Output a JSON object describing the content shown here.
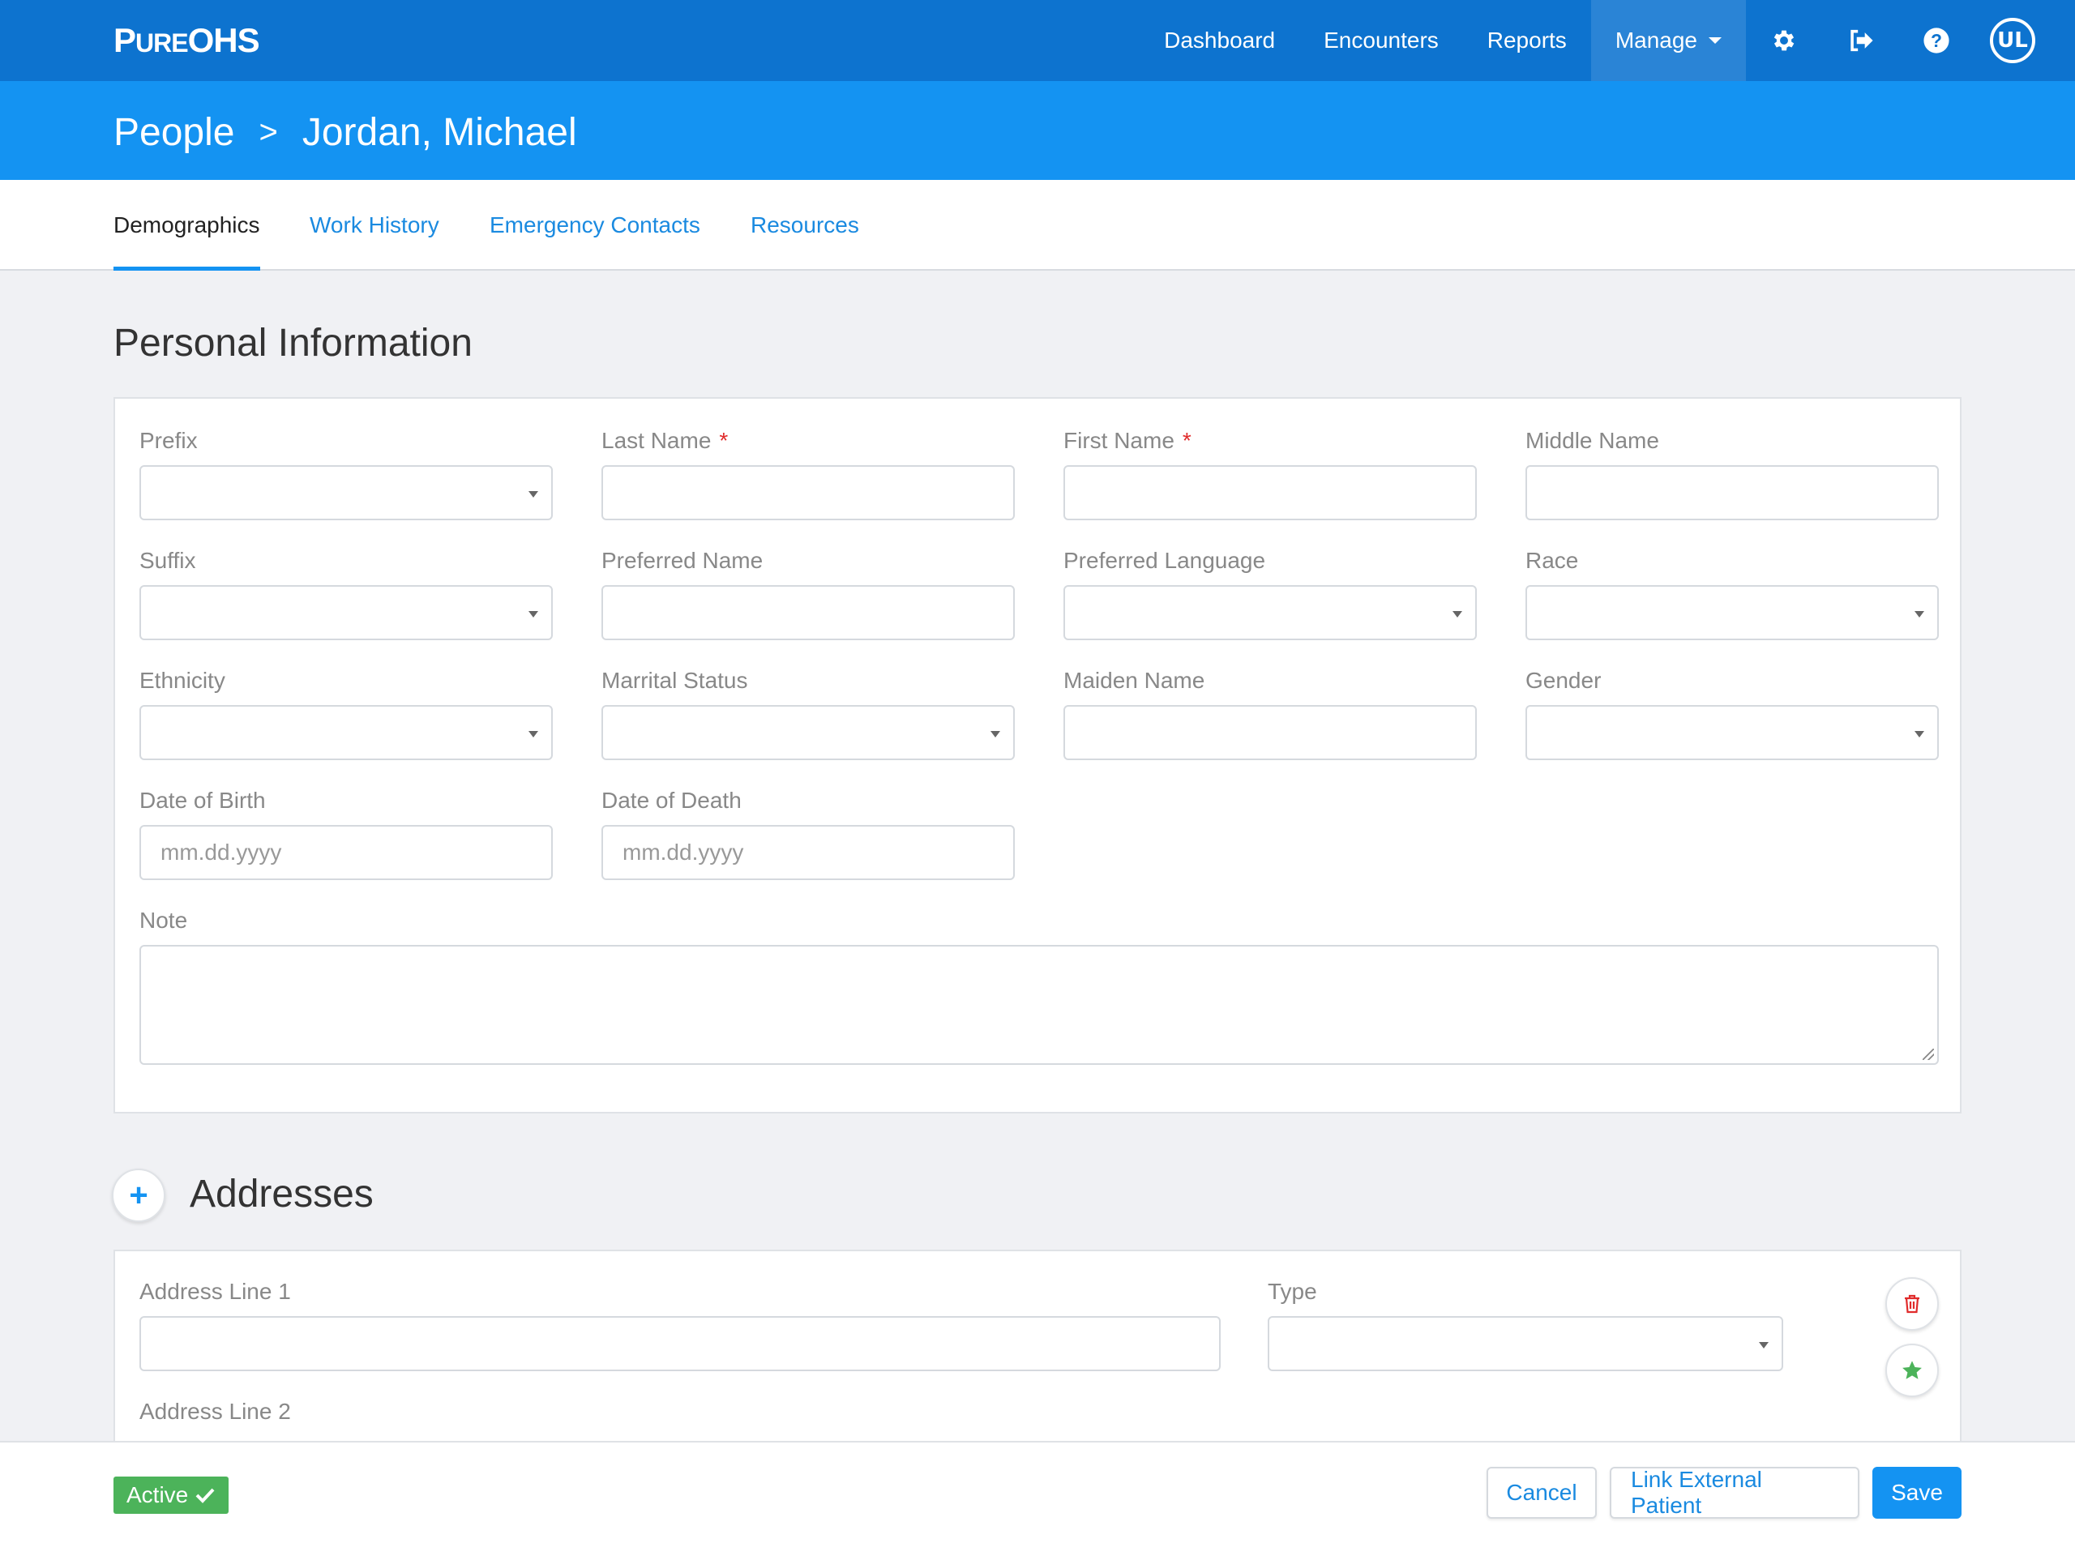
{
  "app": {
    "logo_first": "P",
    "logo_small": "URE",
    "logo_last": "OHS"
  },
  "nav": {
    "items": [
      "Dashboard",
      "Encounters",
      "Reports",
      "Manage"
    ],
    "icons": [
      "gear-icon",
      "sign-out-icon",
      "help-icon",
      "ul-logo-icon"
    ],
    "ul_text": "UL"
  },
  "breadcrumb": {
    "parent": "People",
    "separator": ">",
    "current": "Jordan, Michael"
  },
  "tabs": [
    {
      "label": "Demographics",
      "active": true
    },
    {
      "label": "Work History",
      "active": false
    },
    {
      "label": "Emergency Contacts",
      "active": false
    },
    {
      "label": "Resources",
      "active": false
    }
  ],
  "personal": {
    "title": "Personal Information",
    "fields": {
      "prefix": {
        "label": "Prefix",
        "value": ""
      },
      "last_name": {
        "label": "Last Name",
        "required": "*",
        "value": ""
      },
      "first_name": {
        "label": "First Name",
        "required": "*",
        "value": ""
      },
      "middle_name": {
        "label": "Middle Name",
        "value": ""
      },
      "suffix": {
        "label": "Suffix",
        "value": ""
      },
      "preferred_name": {
        "label": "Preferred Name",
        "value": ""
      },
      "preferred_language": {
        "label": "Preferred Language",
        "value": ""
      },
      "race": {
        "label": "Race",
        "value": ""
      },
      "ethnicity": {
        "label": "Ethnicity",
        "value": ""
      },
      "marital_status": {
        "label": "Marrital Status",
        "value": ""
      },
      "maiden_name": {
        "label": "Maiden Name",
        "value": ""
      },
      "gender": {
        "label": "Gender",
        "value": ""
      },
      "dob": {
        "label": "Date of Birth",
        "placeholder": "mm.dd.yyyy"
      },
      "dod": {
        "label": "Date of Death",
        "placeholder": "mm.dd.yyyy"
      },
      "note": {
        "label": "Note",
        "value": ""
      }
    }
  },
  "addresses": {
    "title": "Addresses",
    "add_icon": "+",
    "line1": {
      "label": "Address Line 1",
      "value": ""
    },
    "type": {
      "label": "Type",
      "value": ""
    },
    "line2": {
      "label": "Address Line 2"
    }
  },
  "footer": {
    "status": "Active",
    "cancel": "Cancel",
    "link_external": "Link External Patient",
    "save": "Save"
  },
  "colors": {
    "nav_bg": "#0d73cf",
    "crumb_bg": "#1493f2",
    "accent": "#1493f2",
    "required": "#e02b2b",
    "active_badge": "#4cb35a",
    "delete_icon": "#e02b2b",
    "star_icon": "#4cb35a"
  }
}
